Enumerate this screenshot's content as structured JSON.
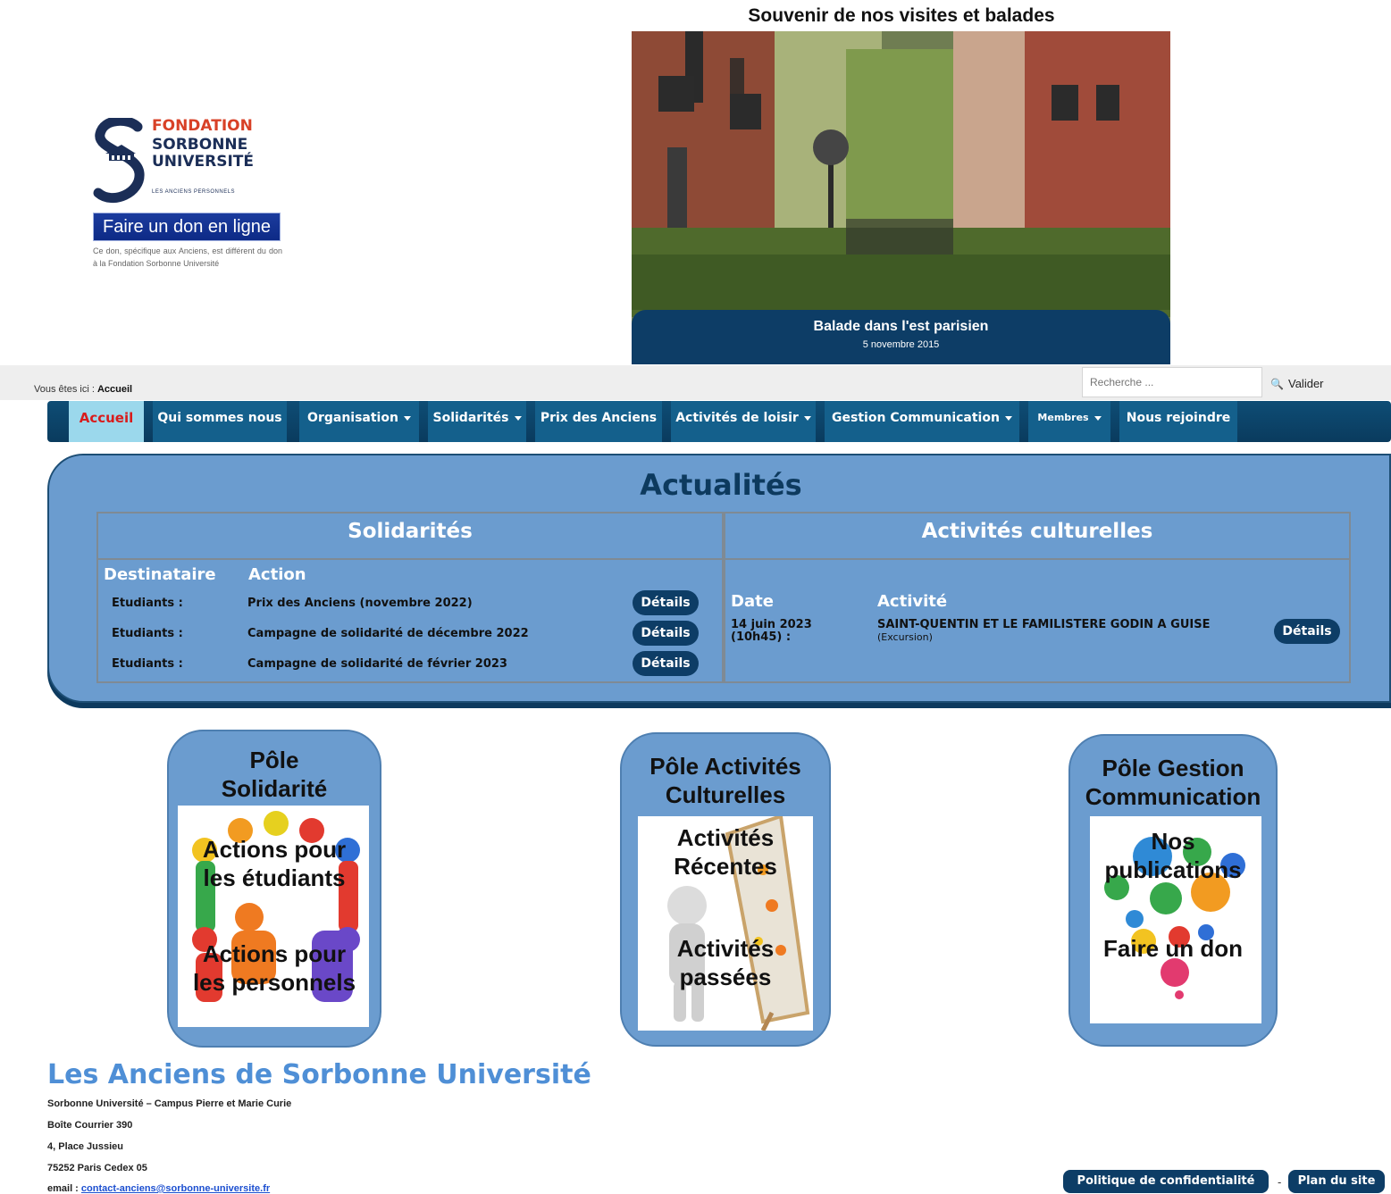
{
  "logo": {
    "line1": "FONDATION",
    "line2": "SORBONNE",
    "line3": "UNIVERSITÉ",
    "subtitle": "LES ANCIENS PERSONNELS"
  },
  "donate": {
    "button": "Faire un don en ligne",
    "note": "Ce don, spécifique aux Anciens, est différent du don à la Fondation Sorbonne Université"
  },
  "carousel": {
    "heading": "Souvenir de nos visites et balades",
    "caption_title": "Balade dans l'est parisien",
    "caption_date": "5 novembre 2015"
  },
  "breadcrumb": {
    "prefix": "Vous êtes ici :",
    "current": "Accueil"
  },
  "search": {
    "placeholder": "Recherche ...",
    "button": "Valider"
  },
  "nav": {
    "items": [
      {
        "label": "Accueil"
      },
      {
        "label": "Qui sommes nous"
      },
      {
        "label": "Organisation"
      },
      {
        "label": "Solidarités"
      },
      {
        "label": "Prix des Anciens"
      },
      {
        "label": "Activités de loisir"
      },
      {
        "label": "Gestion Communication"
      },
      {
        "label": "Membres"
      },
      {
        "label": "Nous rejoindre"
      }
    ]
  },
  "actualites": {
    "title": "Actualités",
    "solidarites": {
      "title": "Solidarités",
      "col_dest": "Destinataire",
      "col_action": "Action",
      "rows": [
        {
          "dest": "Etudiants :",
          "action": "Prix des Anciens (novembre 2022)",
          "btn": "Détails"
        },
        {
          "dest": "Etudiants :",
          "action": "Campagne de solidarité de décembre 2022",
          "btn": "Détails"
        },
        {
          "dest": "Etudiants :",
          "action": "Campagne de solidarité de février 2023",
          "btn": "Détails"
        }
      ]
    },
    "culture": {
      "title": "Activités culturelles",
      "col_date": "Date",
      "col_activity": "Activité",
      "rows": [
        {
          "date1": "14 juin 2023",
          "date2": "(10h45) :",
          "activity": "SAINT-QUENTIN ET LE FAMILISTERE GODIN A GUISE",
          "type": "(Excursion)",
          "btn": "Détails"
        }
      ]
    }
  },
  "poles": [
    {
      "title1": "Pôle",
      "title2": "Solidarité",
      "link1a": "Actions pour",
      "link1b": "les étudiants",
      "link2a": "Actions pour",
      "link2b": "les personnels"
    },
    {
      "title1": "Pôle Activités",
      "title2": "Culturelles",
      "link1a": "Activités",
      "link1b": "Récentes",
      "link2a": "Activités",
      "link2b": "passées"
    },
    {
      "title1": "Pôle Gestion",
      "title2": "Communication",
      "link1a": "Nos",
      "link1b": "publications",
      "link2a": "Faire un don"
    }
  ],
  "footer": {
    "title": "Les Anciens de Sorbonne Université",
    "line1": "Sorbonne Université – Campus Pierre et Marie Curie",
    "line2": "Boîte Courrier 390",
    "line3": "4, Place Jussieu",
    "line4": "75252 Paris Cedex 05",
    "email_label": "email :",
    "email": "contact-anciens@sorbonne-universite.fr",
    "privacy": "Politique de confidentialité",
    "sitemap": "Plan du site",
    "sep": "-"
  },
  "colors": {
    "accent": "#6b9ccf",
    "navy": "#0d3d66",
    "brand_red": "#d84127",
    "brand_navy": "#1b2e57"
  }
}
